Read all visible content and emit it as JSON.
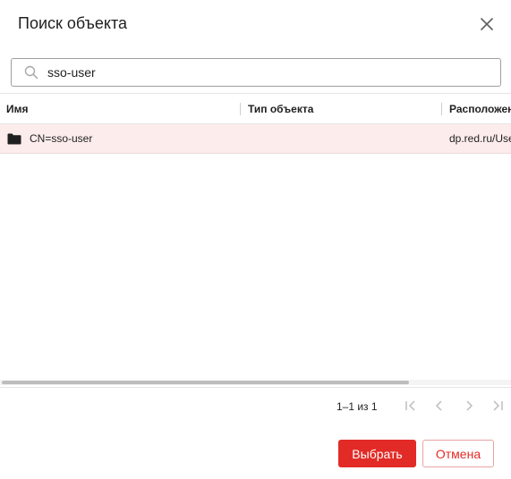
{
  "dialog": {
    "title": "Поиск объекта"
  },
  "search": {
    "value": "sso-user",
    "placeholder": ""
  },
  "table": {
    "columns": [
      "Имя",
      "Тип объекта",
      "Расположение"
    ],
    "rows": [
      {
        "name": "CN=sso-user",
        "type": "",
        "location": "dp.red.ru/Users",
        "icon": "folder-icon",
        "selected": true
      }
    ]
  },
  "pagination": {
    "range_label": "1–1 из 1"
  },
  "footer": {
    "select_label": "Выбрать",
    "cancel_label": "Отмена"
  },
  "colors": {
    "accent": "#e22b26",
    "selected_row": "#fdecec",
    "disabled_icon": "#bdbdbd"
  }
}
